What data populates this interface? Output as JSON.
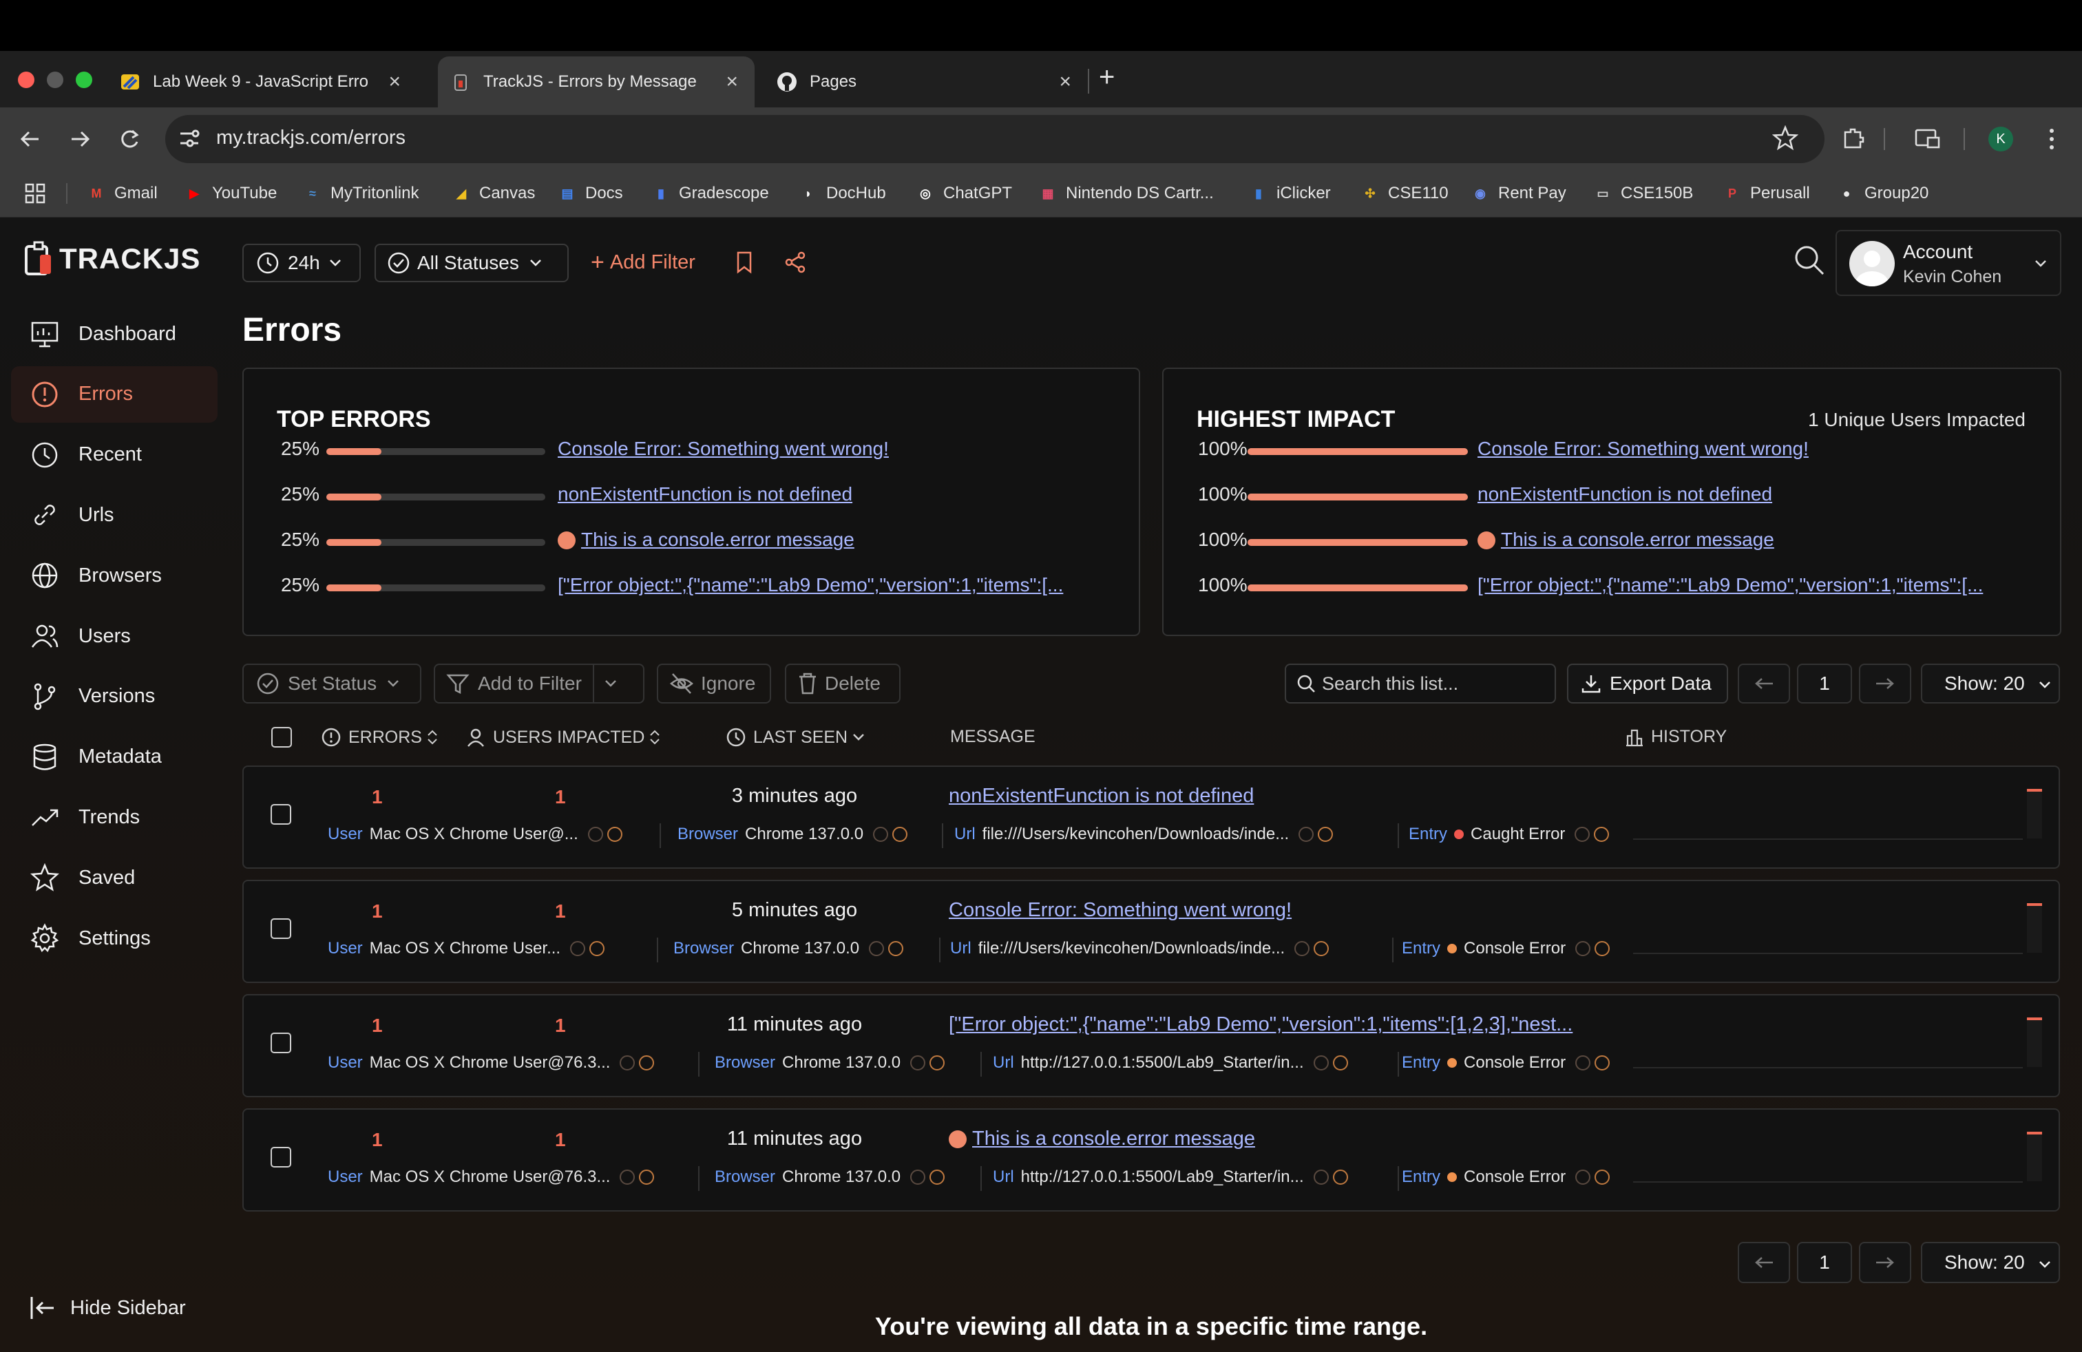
{
  "browser": {
    "tabs": [
      {
        "label": "Lab Week 9 - JavaScript Erro"
      },
      {
        "label": "TrackJS - Errors by Message"
      },
      {
        "label": "Pages"
      }
    ],
    "url": "my.trackjs.com/errors",
    "profile_initial": "K",
    "bookmarks": [
      "Gmail",
      "YouTube",
      "MyTritonlink",
      "Canvas",
      "Docs",
      "Gradescope",
      "DocHub",
      "ChatGPT",
      "Nintendo DS Cartr...",
      "iClicker",
      "CSE110",
      "Rent Pay",
      "CSE150B",
      "Perusall",
      "Group20"
    ]
  },
  "app": {
    "logo": "TRACKJS",
    "filters": {
      "time": "24h",
      "status": "All Statuses",
      "add_filter": "Add Filter"
    },
    "account": {
      "label": "Account",
      "name": "Kevin Cohen"
    },
    "page_title": "Errors",
    "sidebar": [
      {
        "label": "Dashboard"
      },
      {
        "label": "Errors"
      },
      {
        "label": "Recent"
      },
      {
        "label": "Urls"
      },
      {
        "label": "Browsers"
      },
      {
        "label": "Users"
      },
      {
        "label": "Versions"
      },
      {
        "label": "Metadata"
      },
      {
        "label": "Trends"
      },
      {
        "label": "Saved"
      },
      {
        "label": "Settings"
      }
    ],
    "hide_sidebar": "Hide Sidebar"
  },
  "top_errors": {
    "title": "TOP ERRORS",
    "items": [
      {
        "pct": "25%",
        "fraction": 0.25,
        "message": "Console Error: Something went wrong!"
      },
      {
        "pct": "25%",
        "fraction": 0.25,
        "message": "nonExistentFunction is not defined"
      },
      {
        "pct": "25%",
        "fraction": 0.25,
        "message": "This is a console.error message"
      },
      {
        "pct": "25%",
        "fraction": 0.25,
        "message": "[\"Error object:\",{\"name\":\"Lab9 Demo\",\"version\":1,\"items\":[..."
      }
    ]
  },
  "highest_impact": {
    "title": "HIGHEST IMPACT",
    "summary": "1 Unique Users Impacted",
    "items": [
      {
        "pct": "100%",
        "fraction": 1.0,
        "message": "Console Error: Something went wrong!"
      },
      {
        "pct": "100%",
        "fraction": 1.0,
        "message": "nonExistentFunction is not defined"
      },
      {
        "pct": "100%",
        "fraction": 1.0,
        "message": "This is a console.error message"
      },
      {
        "pct": "100%",
        "fraction": 1.0,
        "message": "[\"Error object:\",{\"name\":\"Lab9 Demo\",\"version\":1,\"items\":[..."
      }
    ]
  },
  "toolbar": {
    "set_status": "Set Status",
    "add_to_filter": "Add to Filter",
    "ignore": "Ignore",
    "delete": "Delete",
    "search_placeholder": "Search this list...",
    "export": "Export Data",
    "page": "1",
    "show": "Show: 20"
  },
  "columns": {
    "errors": "ERRORS",
    "users": "USERS IMPACTED",
    "last_seen": "LAST SEEN",
    "message": "MESSAGE",
    "history": "HISTORY"
  },
  "rows": [
    {
      "errors": "1",
      "users": "1",
      "last_seen": "3 minutes ago",
      "message": "nonExistentFunction is not defined",
      "user_key": "User",
      "user": "Mac OS X Chrome User@...",
      "browser_key": "Browser",
      "browser": "Chrome 137.0.0",
      "url_key": "Url",
      "url": "file:///Users/kevincohen/Downloads/inde...",
      "entry_key": "Entry",
      "entry": "Caught Error",
      "entry_color": "#f0574e"
    },
    {
      "errors": "1",
      "users": "1",
      "last_seen": "5 minutes ago",
      "message": "Console Error: Something went wrong!",
      "user_key": "User",
      "user": "Mac OS X Chrome User...",
      "browser_key": "Browser",
      "browser": "Chrome 137.0.0",
      "url_key": "Url",
      "url": "file:///Users/kevincohen/Downloads/inde...",
      "entry_key": "Entry",
      "entry": "Console Error",
      "entry_color": "#f0924e"
    },
    {
      "errors": "1",
      "users": "1",
      "last_seen": "11 minutes ago",
      "message": "[\"Error object:\",{\"name\":\"Lab9 Demo\",\"version\":1,\"items\":[1,2,3],\"nest...",
      "user_key": "User",
      "user": "Mac OS X Chrome User@76.3...",
      "browser_key": "Browser",
      "browser": "Chrome 137.0.0",
      "url_key": "Url",
      "url": "http://127.0.0.1:5500/Lab9_Starter/in...",
      "entry_key": "Entry",
      "entry": "Console Error",
      "entry_color": "#f0924e"
    },
    {
      "errors": "1",
      "users": "1",
      "last_seen": "11 minutes ago",
      "message": "This is a console.error message",
      "user_key": "User",
      "user": "Mac OS X Chrome User@76.3...",
      "browser_key": "Browser",
      "browser": "Chrome 137.0.0",
      "url_key": "Url",
      "url": "http://127.0.0.1:5500/Lab9_Starter/in...",
      "entry_key": "Entry",
      "entry": "Console Error",
      "entry_color": "#f0924e"
    }
  ],
  "footer_note": "You're viewing all data in a specific time range.",
  "colors": {
    "accent": "#f28b70",
    "link": "#aab8ff",
    "key_blue": "#6ea0ff",
    "count_red": "#f06b55"
  }
}
